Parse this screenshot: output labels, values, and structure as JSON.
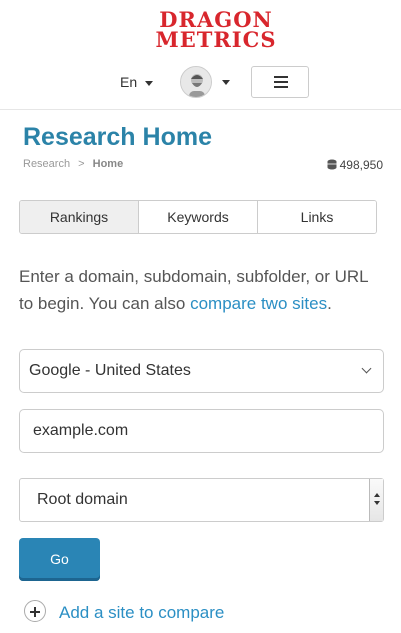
{
  "header": {
    "logo_line1": "DRAGON",
    "logo_line2": "METRICS",
    "language": "En",
    "brand_color": "#d8262d"
  },
  "page": {
    "title": "Research Home",
    "breadcrumb": [
      "Research",
      ">",
      "Home"
    ],
    "credits": "498,950",
    "credits_icon": "coins-icon"
  },
  "tabs": [
    {
      "label": "Rankings",
      "active": true
    },
    {
      "label": "Keywords",
      "active": false
    },
    {
      "label": "Links",
      "active": false
    }
  ],
  "intro": {
    "text": "Enter a domain, subdomain, subfolder, or URL to begin. You can also ",
    "link": "compare two sites",
    "end": "."
  },
  "form": {
    "engine_selected": "Google - United States",
    "domain_placeholder": "example.com",
    "scope_selected": "Root domain",
    "go_label": "Go",
    "add_site_label": "Add a site to compare"
  },
  "colors": {
    "accent": "#2b83a8",
    "link": "#2b8fc4",
    "button": "#2a85b5"
  }
}
